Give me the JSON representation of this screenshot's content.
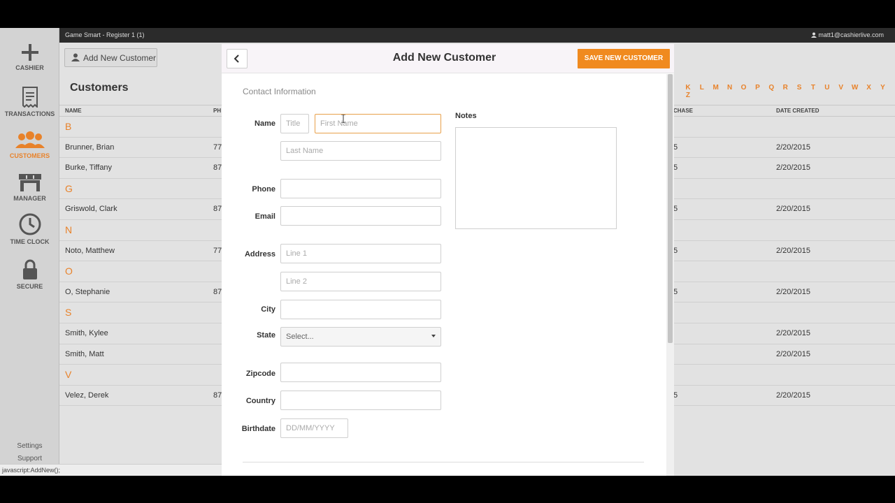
{
  "topbar": {
    "title": "Game Smart - Register 1 (1)",
    "user": "matt1@cashierlive.com"
  },
  "sidebar": {
    "items": [
      {
        "label": "CASHIER",
        "icon": "plus-icon"
      },
      {
        "label": "TRANSACTIONS",
        "icon": "receipt-icon"
      },
      {
        "label": "CUSTOMERS",
        "icon": "people-icon"
      },
      {
        "label": "MANAGER",
        "icon": "store-icon"
      },
      {
        "label": "TIME CLOCK",
        "icon": "clock-icon"
      },
      {
        "label": "SECURE",
        "icon": "lock-icon"
      }
    ],
    "settings": "Settings",
    "support": "Support"
  },
  "page": {
    "add_button": "Add New Customer",
    "title": "Customers",
    "alphabet": [
      "K",
      "L",
      "M",
      "N",
      "O",
      "P",
      "Q",
      "R",
      "S",
      "T",
      "U",
      "V",
      "W",
      "X",
      "Y",
      "Z"
    ],
    "columns": {
      "name": "NAME",
      "phone": "PH",
      "purchase": "CHASE",
      "date_created": "DATE CREATED"
    },
    "rows": [
      {
        "type": "letter",
        "name": "B"
      },
      {
        "type": "customer",
        "name": "Brunner, Brian",
        "phone": "77",
        "purchase": "5",
        "date": "2/20/2015"
      },
      {
        "type": "customer",
        "name": "Burke, Tiffany",
        "phone": "87",
        "purchase": "5",
        "date": "2/20/2015"
      },
      {
        "type": "letter",
        "name": "G"
      },
      {
        "type": "customer",
        "name": "Griswold, Clark",
        "phone": "87",
        "purchase": "5",
        "date": "2/20/2015"
      },
      {
        "type": "letter",
        "name": "N"
      },
      {
        "type": "customer",
        "name": "Noto, Matthew",
        "phone": "77",
        "purchase": "5",
        "date": "2/20/2015"
      },
      {
        "type": "letter",
        "name": "O"
      },
      {
        "type": "customer",
        "name": "O, Stephanie",
        "phone": "87",
        "purchase": "5",
        "date": "2/20/2015"
      },
      {
        "type": "letter",
        "name": "S"
      },
      {
        "type": "customer",
        "name": "Smith, Kylee",
        "phone": "",
        "purchase": "",
        "date": "2/20/2015"
      },
      {
        "type": "customer",
        "name": "Smith, Matt",
        "phone": "",
        "purchase": "",
        "date": "2/20/2015"
      },
      {
        "type": "letter",
        "name": "V"
      },
      {
        "type": "customer",
        "name": "Velez, Derek",
        "phone": "87",
        "purchase": "5",
        "date": "2/20/2015"
      }
    ]
  },
  "status_bar": "javascript:AddNew();",
  "modal": {
    "title": "Add New Customer",
    "save_label": "SAVE NEW CUSTOMER",
    "section_title": "Contact Information",
    "labels": {
      "name": "Name",
      "phone": "Phone",
      "email": "Email",
      "address": "Address",
      "city": "City",
      "state": "State",
      "zipcode": "Zipcode",
      "country": "Country",
      "birthdate": "Birthdate",
      "notes": "Notes"
    },
    "placeholders": {
      "title": "Title",
      "first_name": "First Name",
      "last_name": "Last Name",
      "line1": "Line 1",
      "line2": "Line 2",
      "birthdate": "DD/MM/YYYY"
    },
    "state_select": "Select..."
  },
  "colors": {
    "accent": "#e8822a",
    "save_button": "#f08a1f",
    "topbar": "#2b2b2b"
  }
}
